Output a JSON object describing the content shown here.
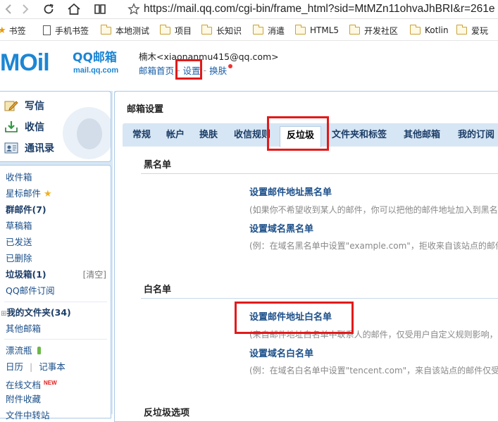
{
  "browser": {
    "url": "https://mail.qq.com/cgi-bin/frame_html?sid=MtMZn11ohvaJhBRI&r=261e"
  },
  "bookmarks": [
    {
      "label": "书签",
      "icon": "star-icon"
    },
    {
      "label": "手机书签",
      "icon": "page-icon"
    },
    {
      "label": "本地测试",
      "icon": "folder-icon"
    },
    {
      "label": "项目",
      "icon": "folder-icon"
    },
    {
      "label": "长知识",
      "icon": "folder-icon"
    },
    {
      "label": "消遣",
      "icon": "folder-icon"
    },
    {
      "label": "HTML5",
      "icon": "folder-icon"
    },
    {
      "label": "开发社区",
      "icon": "folder-icon"
    },
    {
      "label": "Kotlin",
      "icon": "folder-icon"
    },
    {
      "label": "爱玩",
      "icon": "folder-icon"
    }
  ],
  "header": {
    "logo_big": "MOil",
    "logo_cn": "QQ邮箱",
    "logo_domain": "mail.qq.com",
    "user": "楠木<xiaonanmu415@qq.com>",
    "links": {
      "home": "邮箱首页",
      "settings": "设置",
      "skin": "换肤"
    },
    "separator": "-"
  },
  "quick_actions": [
    {
      "label": "写信",
      "icon": "pen-icon"
    },
    {
      "label": "收信",
      "icon": "inbox-download-icon"
    },
    {
      "label": "通讯录",
      "icon": "contacts-icon"
    }
  ],
  "folders": {
    "inbox": "收件箱",
    "starred": "星标邮件",
    "group_mail": "群邮件",
    "group_count": "(7)",
    "drafts": "草稿箱",
    "sent": "已发送",
    "deleted": "已删除",
    "spam": "垃圾箱",
    "spam_count": "(1)",
    "spam_clear": "[清空]",
    "qq_subscription": "QQ邮件订阅",
    "my_folders": "我的文件夹",
    "my_folders_count": "(34)",
    "other_mailboxes": "其他邮箱",
    "drift_bottle": "漂流瓶",
    "calendar": "日历",
    "calendar_sep": "|",
    "notepad": "记事本",
    "online_docs": "在线文档",
    "new_badge": "NEW",
    "attachments": "附件收藏",
    "file_transfer": "文件中转站"
  },
  "settings": {
    "title": "邮箱设置",
    "tabs": [
      "常规",
      "帐户",
      "换肤",
      "收信规则",
      "反垃圾",
      "文件夹和标签",
      "其他邮箱",
      "我的订阅"
    ],
    "active_tab": "反垃圾",
    "blacklist": {
      "title": "黑名单",
      "address_link": "设置邮件地址黑名单",
      "address_desc": "(如果你不希望收到某人的邮件，你可以把他的邮件地址加入到黑名",
      "domain_link": "设置域名黑名单",
      "domain_desc": "(例：在域名黑名单中设置\"example.com\"，拒收来自该站点的邮件"
    },
    "whitelist": {
      "title": "白名单",
      "address_link": "设置邮件地址白名单",
      "address_desc": "(来自邮件地址白名单中联系人的邮件，仅受用户自定义规则影响，",
      "domain_link": "设置域名白名单",
      "domain_desc": "(例：在域名白名单中设置\"tencent.com\"，来自该站点的邮件仅受"
    },
    "antispam_options": {
      "title": "反垃圾选项"
    }
  },
  "colors": {
    "highlight": "#e31a1a",
    "link": "#1b4f8a",
    "tabbar": "#d7e6f4"
  }
}
